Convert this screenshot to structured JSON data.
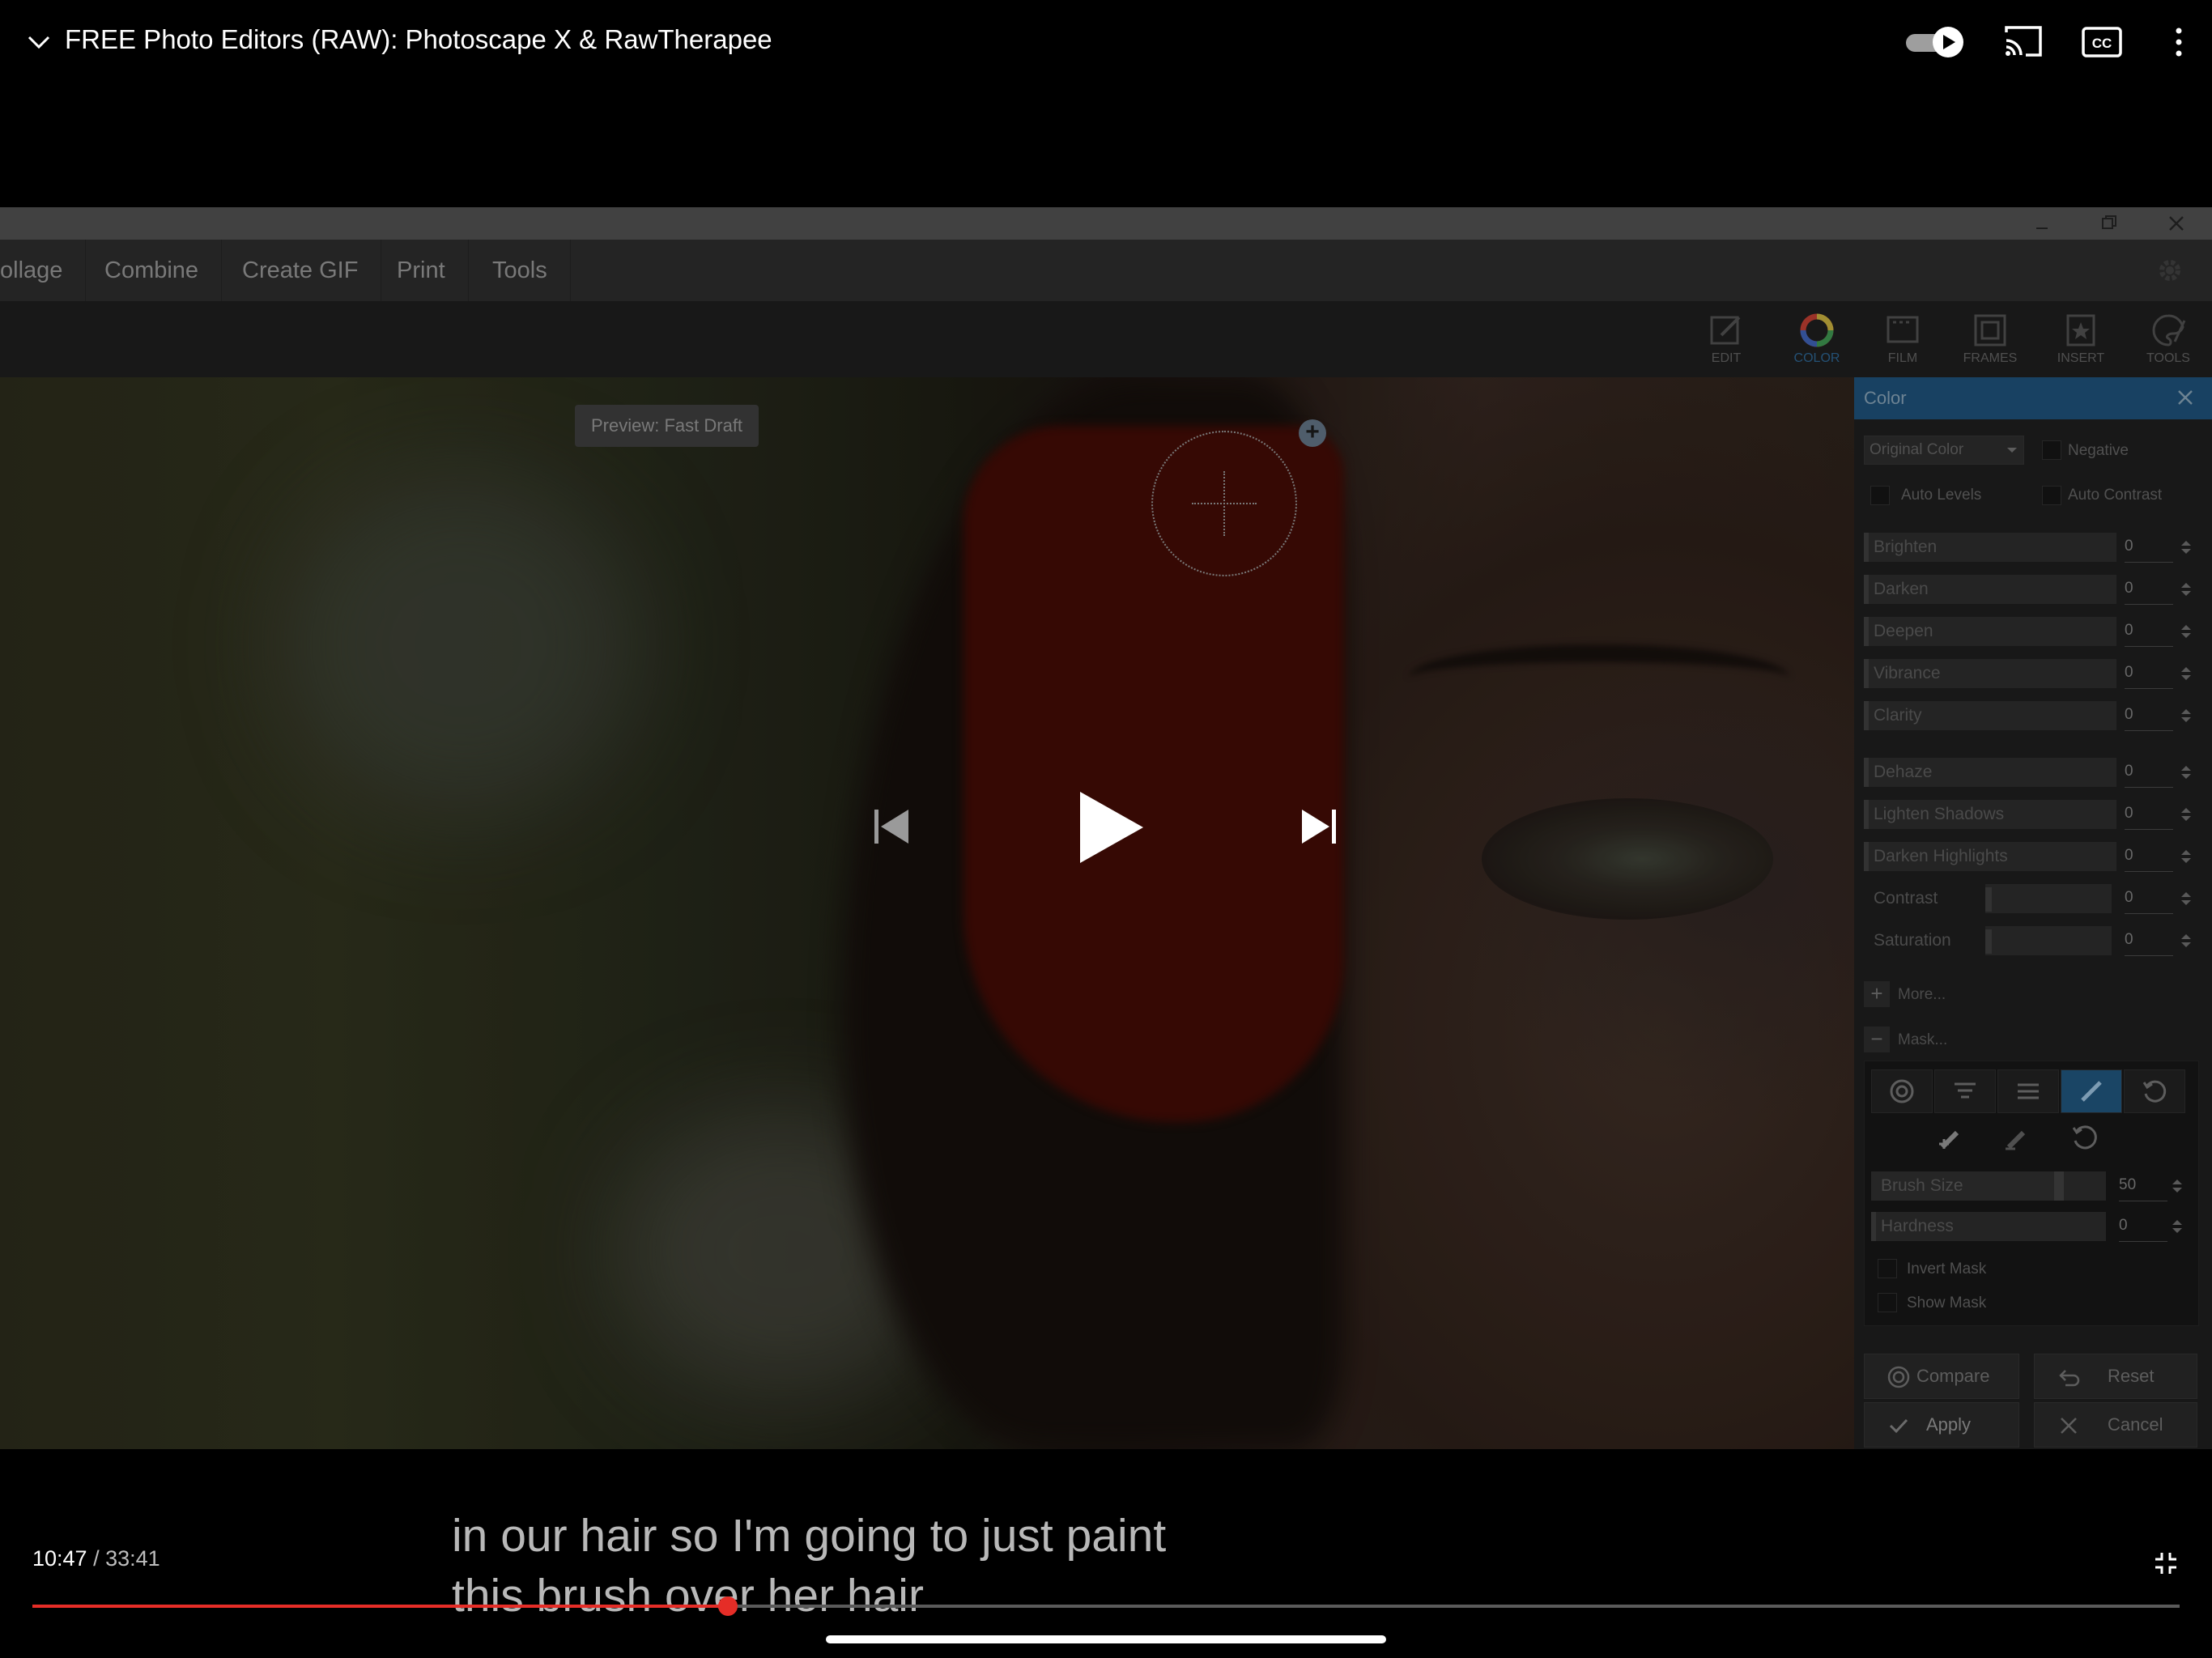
{
  "video": {
    "title": "FREE Photo Editors (RAW): Photoscape X & RawTherapee",
    "current_time": "10:47",
    "separator": " / ",
    "duration": "33:41",
    "progress_fraction": 0.324,
    "caption_line1": "in our hair so I'm going to just paint",
    "caption_line2": "this brush over her hair"
  },
  "topbar": {
    "autoplay_on": true,
    "icons": [
      "chevron-down-icon",
      "autoplay-toggle",
      "cast-icon",
      "cc-icon",
      "more-vert-icon"
    ]
  },
  "app": {
    "menu": [
      "ollage",
      "Combine",
      "Create GIF",
      "Print",
      "Tools"
    ],
    "tools": [
      {
        "label": "EDIT",
        "icon": "edit-icon"
      },
      {
        "label": "COLOR",
        "icon": "color-wheel-icon",
        "active": true
      },
      {
        "label": "FILM",
        "icon": "film-icon"
      },
      {
        "label": "FRAMES",
        "icon": "frames-icon"
      },
      {
        "label": "INSERT",
        "icon": "insert-icon"
      },
      {
        "label": "TOOLS",
        "icon": "palette-icon"
      }
    ],
    "preview_badge": "Preview: Fast Draft",
    "panel": {
      "title": "Color",
      "dropdown": "Original Color",
      "negative": "Negative",
      "auto_levels": "Auto Levels",
      "auto_contrast": "Auto Contrast",
      "sliders_a": [
        {
          "label": "Brighten",
          "value": "0"
        },
        {
          "label": "Darken",
          "value": "0"
        },
        {
          "label": "Deepen",
          "value": "0"
        },
        {
          "label": "Vibrance",
          "value": "0"
        },
        {
          "label": "Clarity",
          "value": "0"
        }
      ],
      "sliders_b": [
        {
          "label": "Dehaze",
          "value": "0"
        },
        {
          "label": "Lighten Shadows",
          "value": "0"
        },
        {
          "label": "Darken Highlights",
          "value": "0"
        },
        {
          "label": "Contrast",
          "value": "0"
        },
        {
          "label": "Saturation",
          "value": "0"
        }
      ],
      "more": "More...",
      "mask": "Mask...",
      "brush_size_label": "Brush Size",
      "brush_size_value": "50",
      "hardness_label": "Hardness",
      "hardness_value": "0",
      "invert_mask": "Invert Mask",
      "show_mask": "Show Mask",
      "compare": "Compare",
      "reset": "Reset",
      "apply": "Apply",
      "cancel": "Cancel"
    }
  },
  "colors": {
    "accent_red": "#e52d27",
    "panel_header": "#1c4b70"
  }
}
